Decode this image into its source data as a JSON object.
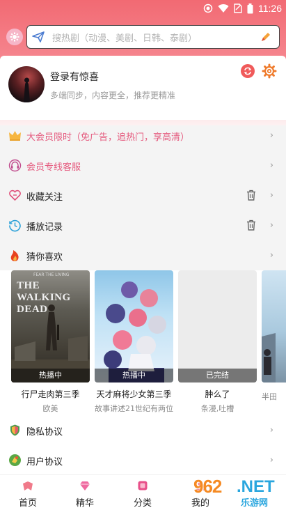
{
  "status_bar": {
    "time": "11:26"
  },
  "search": {
    "placeholder": "搜热剧（动漫、美剧、日韩、泰剧）"
  },
  "profile": {
    "title": "登录有惊喜",
    "subtitle": "多端同步，内容更全，推荐更精准"
  },
  "menu": {
    "vip_promo": "大会员限时（免广告，追热门，享高清）",
    "vip_service": "会员专线客服",
    "favorites": "收藏关注",
    "history": "播放记录",
    "guess": "猜你喜欢",
    "privacy": "隐私协议",
    "user_agreement": "用户协议"
  },
  "cards": [
    {
      "name": "行尸走肉第三季",
      "meta": "欧美",
      "tag": "热播中",
      "poster_title": "THE WALKING DEAD",
      "poster_tagline": "FEAR THE LIVING"
    },
    {
      "name": "天才麻将少女第三季",
      "meta": "故事讲述21世纪有两位...",
      "tag": "热播中"
    },
    {
      "name": "肿么了",
      "meta": "条漫,吐槽",
      "tag": "已完结"
    },
    {
      "name": "",
      "meta": "半田",
      "tag": ""
    }
  ],
  "bottom_nav": [
    {
      "label": "首页",
      "icon": "home-icon"
    },
    {
      "label": "精华",
      "icon": "diamond-icon"
    },
    {
      "label": "分类",
      "icon": "category-icon"
    },
    {
      "label": "我的",
      "icon": "me-icon"
    }
  ],
  "watermark": {
    "number": "962",
    "suffix": ".NET",
    "site": "乐游网"
  },
  "colors": {
    "accent_pink": "#e55a7e",
    "hero_red": "#f26a73",
    "sync_red": "#f05a5a",
    "gear_orange": "#ef7b2c"
  }
}
